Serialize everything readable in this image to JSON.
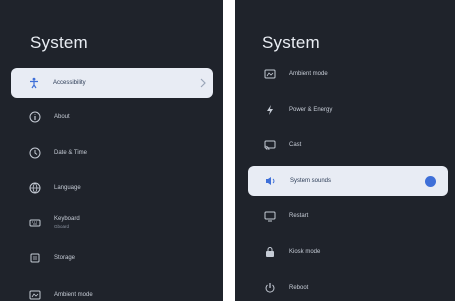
{
  "left_panel": {
    "title": "System",
    "items": [
      {
        "label": "Accessibility",
        "icon": "accessibility-icon",
        "selected": true
      },
      {
        "label": "About",
        "icon": "info-icon"
      },
      {
        "label": "Date & Time",
        "icon": "clock-icon"
      },
      {
        "label": "Language",
        "icon": "globe-icon"
      },
      {
        "label": "Keyboard",
        "sub": "Gboard",
        "icon": "keyboard-icon"
      },
      {
        "label": "Storage",
        "icon": "storage-icon"
      },
      {
        "label": "Ambient mode",
        "icon": "ambient-mode-icon"
      }
    ]
  },
  "right_panel": {
    "title": "System",
    "items": [
      {
        "label": "Ambient mode",
        "icon": "ambient-mode-icon"
      },
      {
        "label": "Power & Energy",
        "icon": "power-energy-icon"
      },
      {
        "label": "Cast",
        "icon": "cast-icon"
      },
      {
        "label": "System sounds",
        "icon": "volume-icon",
        "selected": true,
        "toggle": "on"
      },
      {
        "label": "Restart",
        "icon": "restart-icon"
      },
      {
        "label": "Kiosk mode",
        "icon": "lock-icon"
      },
      {
        "label": "Reboot",
        "icon": "power-icon"
      }
    ]
  },
  "colors": {
    "panel_bg": "#1f232b",
    "selected_bg": "#e8ecf4",
    "accent": "#3e6fd8"
  }
}
